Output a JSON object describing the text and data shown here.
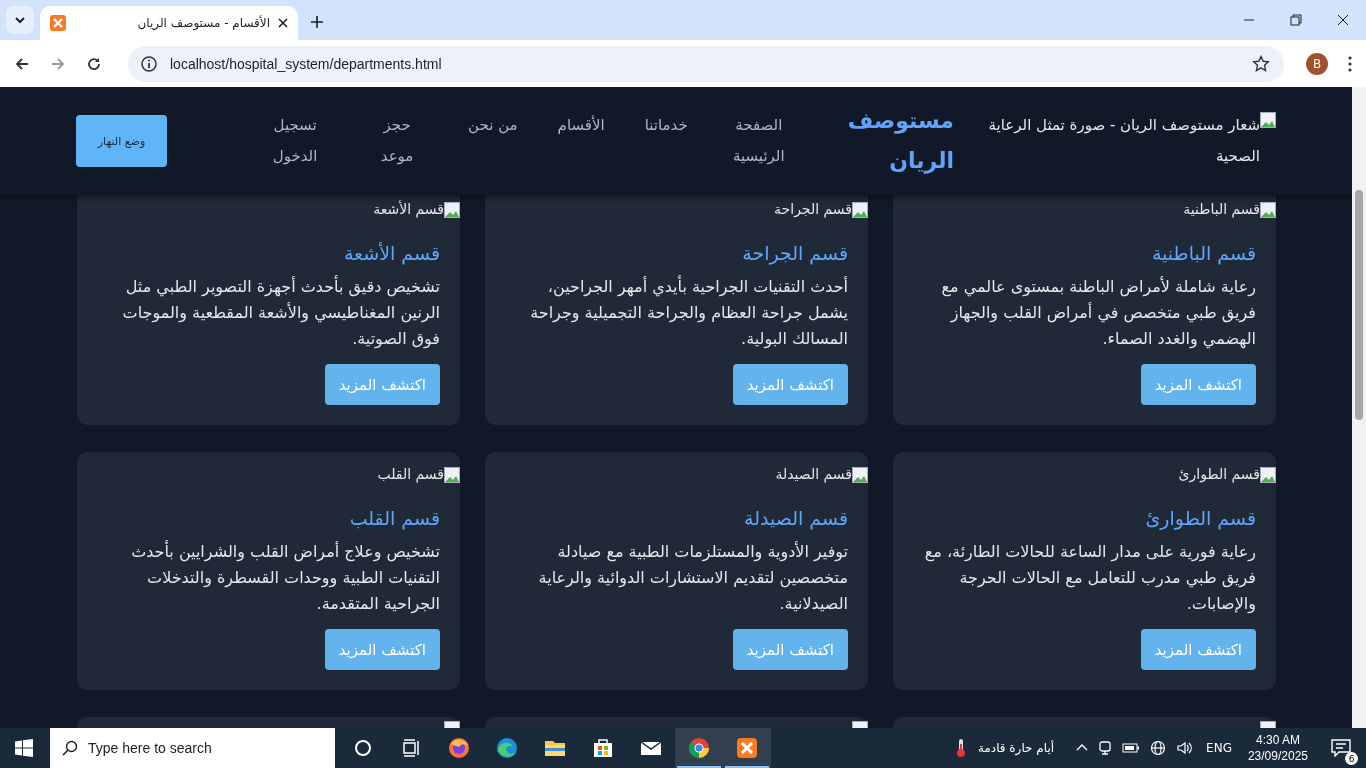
{
  "browser": {
    "tab_title": "الأقسام - مستوصف الريان",
    "url": "localhost/hospital_system/departments.html",
    "profile": "B"
  },
  "header": {
    "logo_alt": "شعار مستوصف الريان - صورة تمثل الرعاية الصحية",
    "brand": "مستوصف الريان",
    "nav": [
      {
        "label": "الصفحة الرئيسية"
      },
      {
        "label": "خدماتنا"
      },
      {
        "label": "الأقسام"
      },
      {
        "label": "من نحن"
      },
      {
        "label": "حجز موعد"
      },
      {
        "label": "تسجيل الدخول"
      }
    ],
    "theme_button": "وضع النهار"
  },
  "departments": [
    {
      "kind": "full",
      "image_alt": "قسم الباطنية",
      "title": "قسم الباطنية",
      "description": "رعاية شاملة لأمراض الباطنة بمستوى عالمي مع فريق طبي متخصص في أمراض القلب والجهاز الهضمي والغدد الصماء.",
      "button": "اكتشف المزيد"
    },
    {
      "kind": "full",
      "image_alt": "قسم الجراحة",
      "title": "قسم الجراحة",
      "description": "أحدث التقنيات الجراحية بأيدي أمهر الجراحين، يشمل جراحة العظام والجراحة التجميلية وجراحة المسالك البولية.",
      "button": "اكتشف المزيد"
    },
    {
      "kind": "full",
      "image_alt": "قسم الأشعة",
      "title": "قسم الأشعة",
      "description": "تشخيص دقيق بأحدث أجهزة التصوير الطبي مثل الرنين المغناطيسي والأشعة المقطعية والموجات فوق الصوتية.",
      "button": "اكتشف المزيد"
    },
    {
      "kind": "full",
      "image_alt": "قسم الطوارئ",
      "title": "قسم الطوارئ",
      "description": "رعاية فورية على مدار الساعة للحالات الطارئة، مع فريق طبي مدرب للتعامل مع الحالات الحرجة والإصابات.",
      "button": "اكتشف المزيد"
    },
    {
      "kind": "full",
      "image_alt": "قسم الصيدلة",
      "title": "قسم الصيدلة",
      "description": "توفير الأدوية والمستلزمات الطبية مع صيادلة متخصصين لتقديم الاستشارات الدوائية والرعاية الصيدلانية.",
      "button": "اكتشف المزيد"
    },
    {
      "kind": "full",
      "image_alt": "قسم القلب",
      "title": "قسم القلب",
      "description": "تشخيص وعلاج أمراض القلب والشرايين بأحدث التقنيات الطبية ووحدات القسطرة والتدخلات الجراحية المتقدمة.",
      "button": "اكتشف المزيد"
    },
    {
      "kind": "cut"
    },
    {
      "kind": "cut"
    },
    {
      "kind": "cut"
    }
  ],
  "taskbar": {
    "search_placeholder": "Type here to search",
    "apps": [
      {
        "kind": "cortana",
        "running": false
      },
      {
        "kind": "taskview",
        "running": false
      },
      {
        "kind": "firefox",
        "running": false
      },
      {
        "kind": "edge",
        "running": false
      },
      {
        "kind": "files",
        "running": false
      },
      {
        "kind": "store",
        "running": false
      },
      {
        "kind": "mail",
        "running": false
      },
      {
        "kind": "chrome",
        "running": true
      },
      {
        "kind": "xampp",
        "running": true
      }
    ],
    "weather": "أيام حارة قادمة",
    "language": "ENG",
    "time": "4:30 AM",
    "date": "23/09/2025",
    "notifications": "6"
  }
}
